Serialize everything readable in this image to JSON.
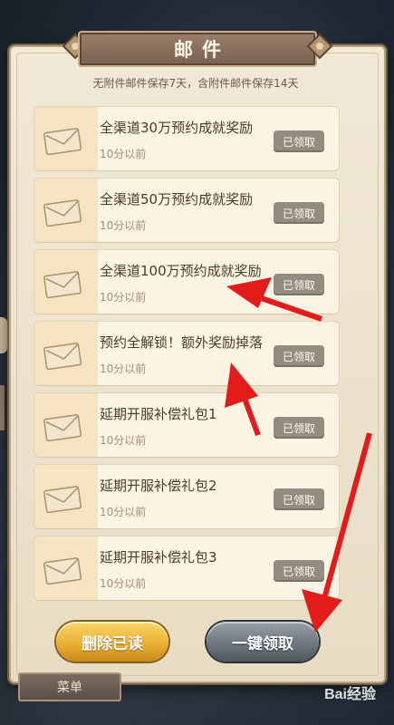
{
  "header": {
    "title": "邮件"
  },
  "notice": "无附件邮件保存7天，含附件邮件保存14天",
  "mails": [
    {
      "title": "全渠道30万预约成就奖励",
      "time": "10分以前",
      "status": "已领取"
    },
    {
      "title": "全渠道50万预约成就奖励",
      "time": "10分以前",
      "status": "已领取"
    },
    {
      "title": "全渠道100万预约成就奖励",
      "time": "10分以前",
      "status": "已领取"
    },
    {
      "title": "预约全解锁！额外奖励掉落",
      "time": "10分以前",
      "status": "已领取"
    },
    {
      "title": "延期开服补偿礼包1",
      "time": "10分以前",
      "status": "已领取"
    },
    {
      "title": "延期开服补偿礼包2",
      "time": "10分以前",
      "status": "已领取"
    },
    {
      "title": "延期开服补偿礼包3",
      "time": "10分以前",
      "status": "已领取"
    }
  ],
  "buttons": {
    "delete_read": "删除已读",
    "claim_all": "一键领取"
  },
  "menu": {
    "label": "菜单"
  },
  "watermark": "Bai经验",
  "colors": {
    "annotation_arrow": "#e21b1b",
    "claimed_badge": "#958c80",
    "delete_button": "#e7ac2f",
    "claim_button": "#6c737c"
  }
}
